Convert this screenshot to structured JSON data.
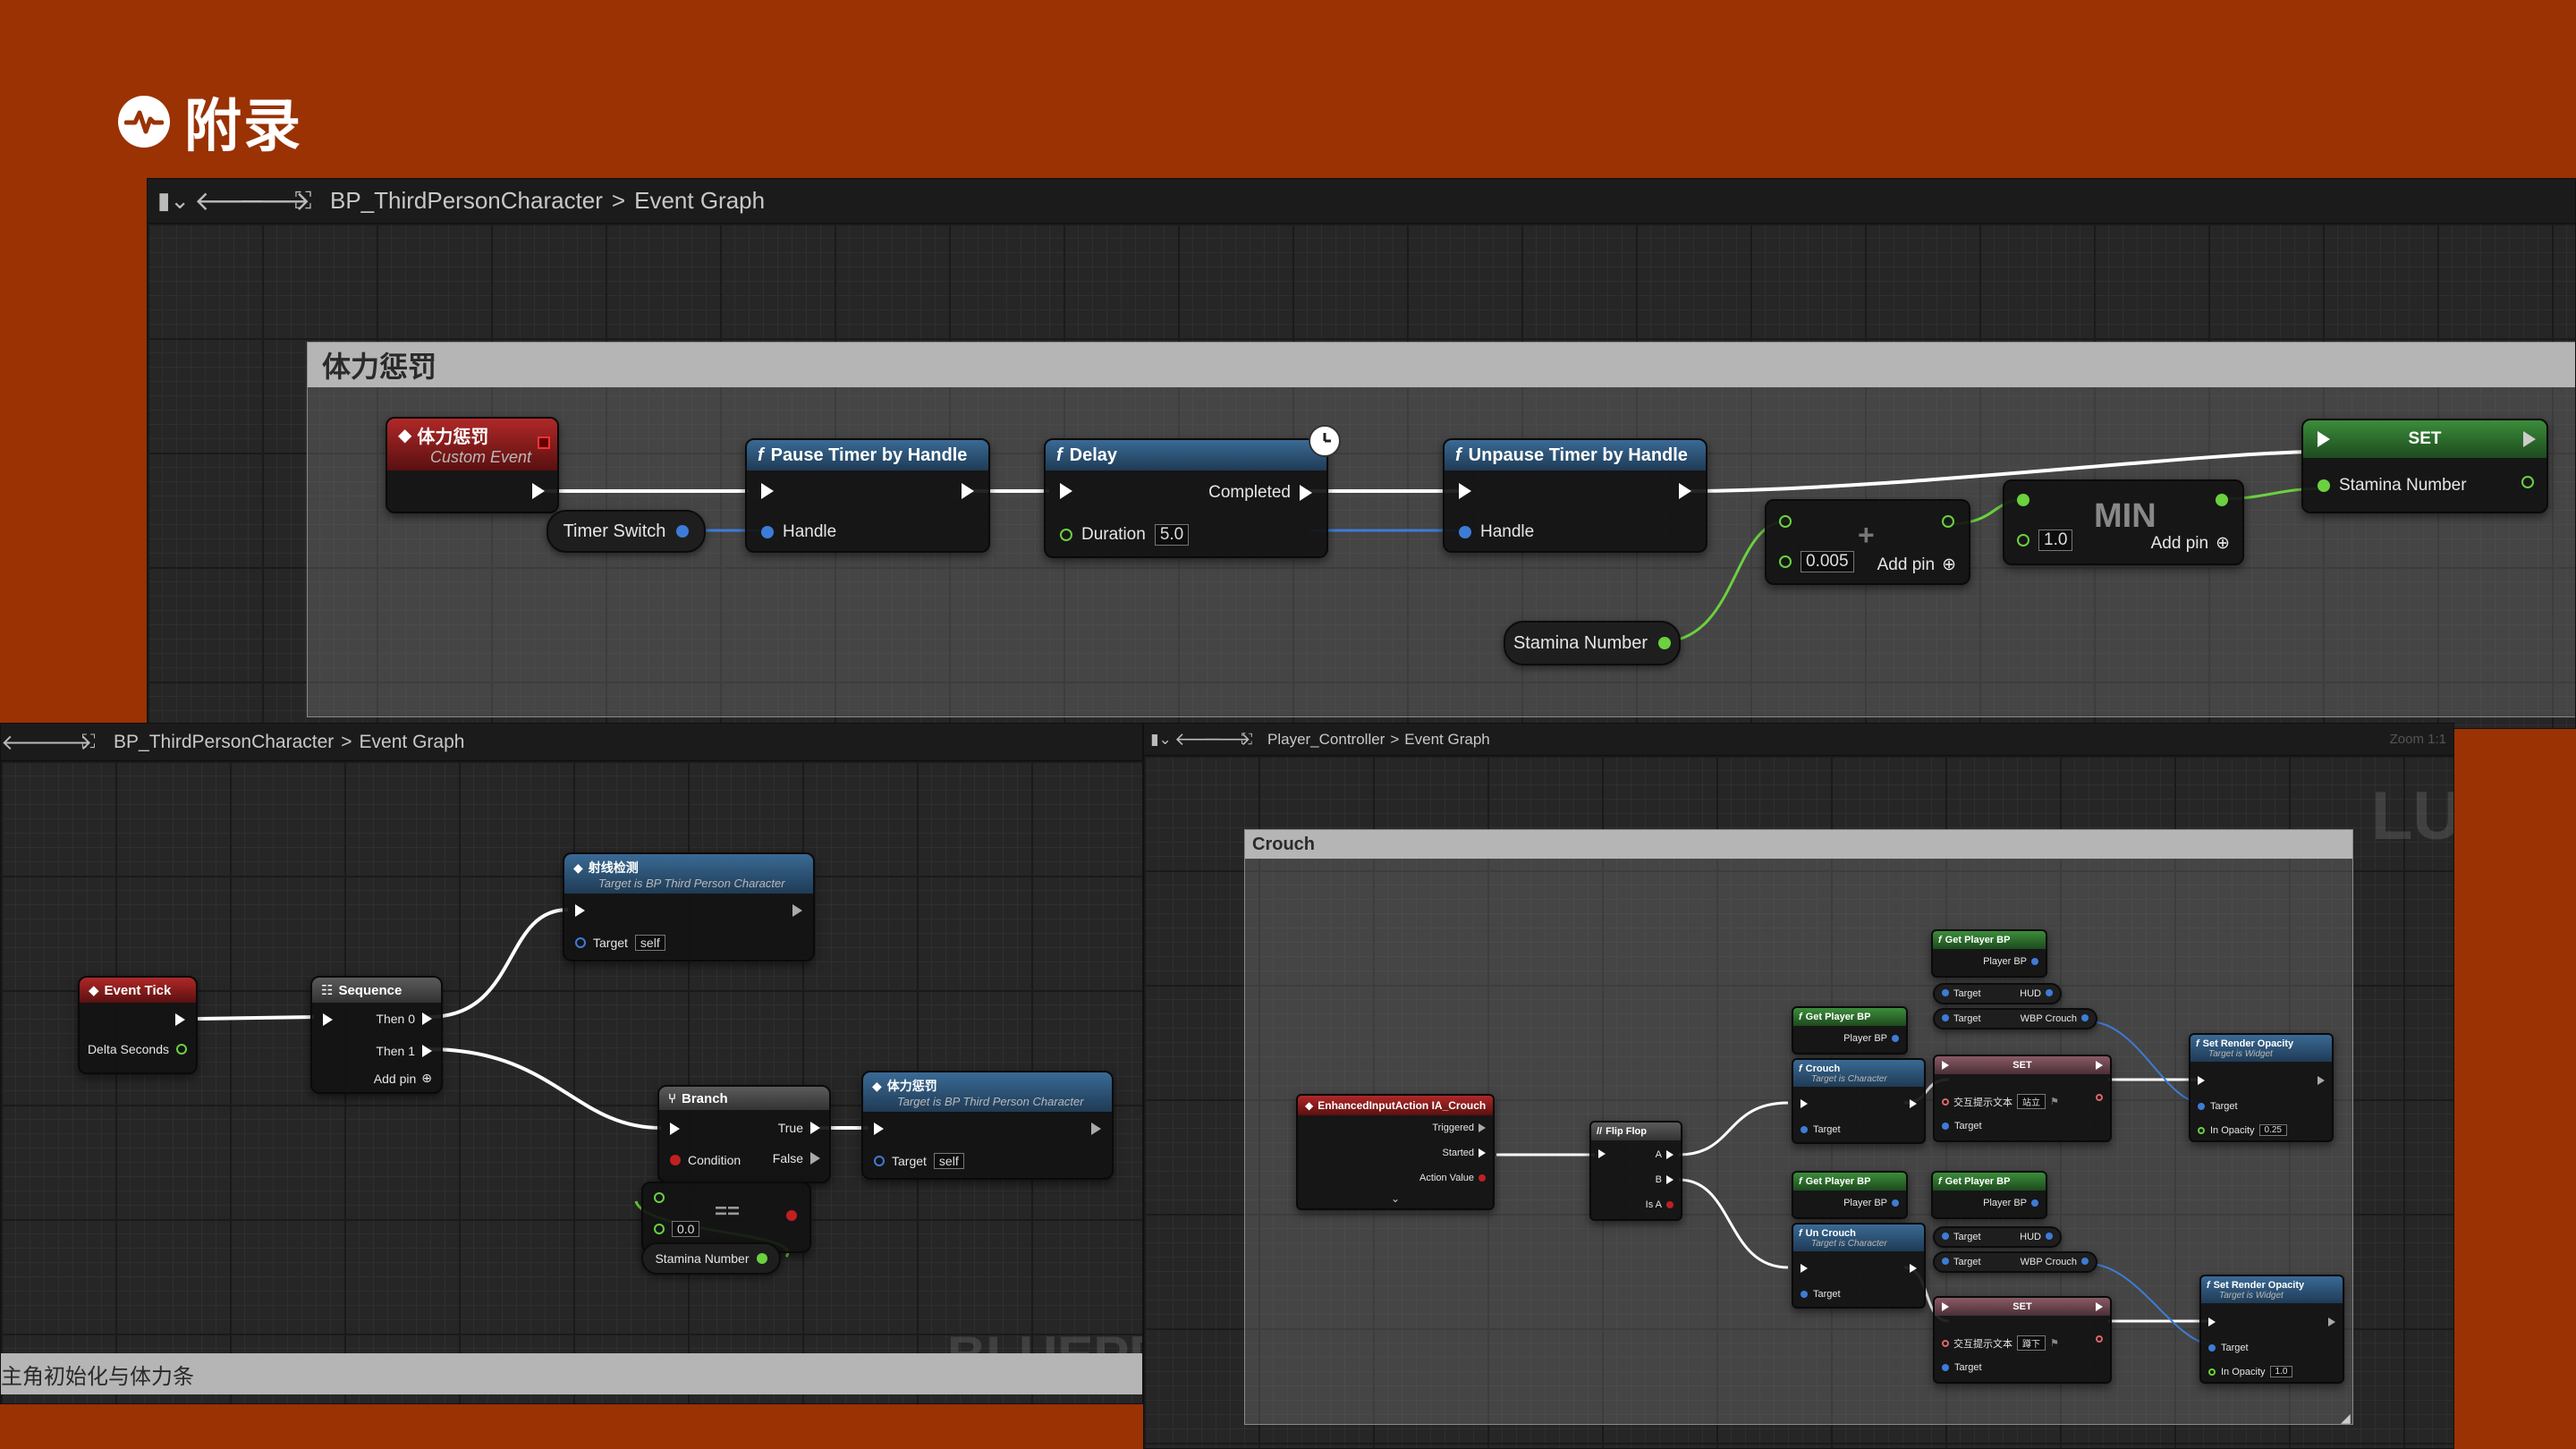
{
  "slide": {
    "title": "附录"
  },
  "top_panel": {
    "breadcrumb_blueprint": "BP_ThirdPersonCharacter",
    "breadcrumb_graph": "Event Graph",
    "comment": "体力惩罚",
    "nodes": {
      "custom_event": {
        "title": "体力惩罚",
        "subtitle": "Custom Event"
      },
      "timer_switch": "Timer Switch",
      "pause_timer": {
        "title": "Pause Timer by Handle",
        "handle": "Handle"
      },
      "delay": {
        "title": "Delay",
        "completed": "Completed",
        "duration_label": "Duration",
        "duration_value": "5.0"
      },
      "unpause_timer": {
        "title": "Unpause Timer by Handle",
        "handle": "Handle"
      },
      "add": {
        "value": "0.005",
        "add_pin": "Add pin",
        "op": "+"
      },
      "min": {
        "value": "1.0",
        "add_pin": "Add pin",
        "op": "MIN"
      },
      "set": {
        "title": "SET",
        "var": "Stamina Number"
      },
      "stamina_get": "Stamina Number"
    }
  },
  "left_panel": {
    "breadcrumb_blueprint": "BP_ThirdPersonCharacter",
    "breadcrumb_graph": "Event Graph",
    "comment": "主角初始化与体力条",
    "watermark": "BLUEPR",
    "nodes": {
      "event_tick": {
        "title": "Event Tick",
        "delta": "Delta Seconds"
      },
      "sequence": {
        "title": "Sequence",
        "then0": "Then 0",
        "then1": "Then 1",
        "add_pin": "Add pin"
      },
      "raycast": {
        "title": "射线检测",
        "subtitle": "Target is BP Third Person Character",
        "target": "Target",
        "target_value": "self"
      },
      "branch": {
        "title": "Branch",
        "true": "True",
        "false": "False",
        "condition": "Condition"
      },
      "penalty": {
        "title": "体力惩罚",
        "subtitle": "Target is BP Third Person Character",
        "target": "Target",
        "target_value": "self"
      },
      "equal": {
        "op": "==",
        "value": "0.0"
      },
      "stamina_get": "Stamina Number"
    }
  },
  "right_panel": {
    "breadcrumb_blueprint": "Player_Controller",
    "breadcrumb_graph": "Event Graph",
    "zoom": "Zoom 1:1",
    "watermark": "LUEP",
    "comment": "Crouch",
    "nodes": {
      "input_action": {
        "title": "EnhancedInputAction IA_Crouch",
        "triggered": "Triggered",
        "started": "Started",
        "action_value": "Action Value"
      },
      "flipflop": {
        "title": "Flip Flop",
        "a": "A",
        "b": "B",
        "is_a": "Is A"
      },
      "get_player_1": {
        "title": "Get Player BP",
        "out": "Player BP"
      },
      "get_player_2": {
        "title": "Get Player BP",
        "out": "Player BP"
      },
      "get_player_3": {
        "title": "Get Player BP",
        "out": "Player BP"
      },
      "get_player_4": {
        "title": "Get Player BP",
        "out": "Player BP"
      },
      "crouch": {
        "title": "Crouch",
        "subtitle": "Target is Character",
        "target": "Target"
      },
      "uncrouch": {
        "title": "Un Crouch",
        "subtitle": "Target is Character",
        "target": "Target"
      },
      "hud_1": {
        "target": "Target",
        "out": "HUD"
      },
      "wbp_1": {
        "target": "Target",
        "out": "WBP Crouch"
      },
      "hud_2": {
        "target": "Target",
        "out": "HUD"
      },
      "wbp_2": {
        "target": "Target",
        "out": "WBP Crouch"
      },
      "set_1": {
        "title": "SET",
        "var": "交互提示文本",
        "value": "站立",
        "target": "Target"
      },
      "set_2": {
        "title": "SET",
        "var": "交互提示文本",
        "value": "蹲下",
        "target": "Target"
      },
      "opacity_1": {
        "title": "Set Render Opacity",
        "subtitle": "Target is Widget",
        "target": "Target",
        "opacity": "In Opacity",
        "value": "0.25"
      },
      "opacity_2": {
        "title": "Set Render Opacity",
        "subtitle": "Target is Widget",
        "target": "Target",
        "opacity": "In Opacity",
        "value": "1.0"
      }
    }
  },
  "colors": {
    "background": "#9a3204",
    "function_header": "#2c5478",
    "event_header": "#9e2020",
    "exec_wire": "#ffffff",
    "float_wire": "#6bd13f",
    "object_wire": "#3d7cd6"
  }
}
